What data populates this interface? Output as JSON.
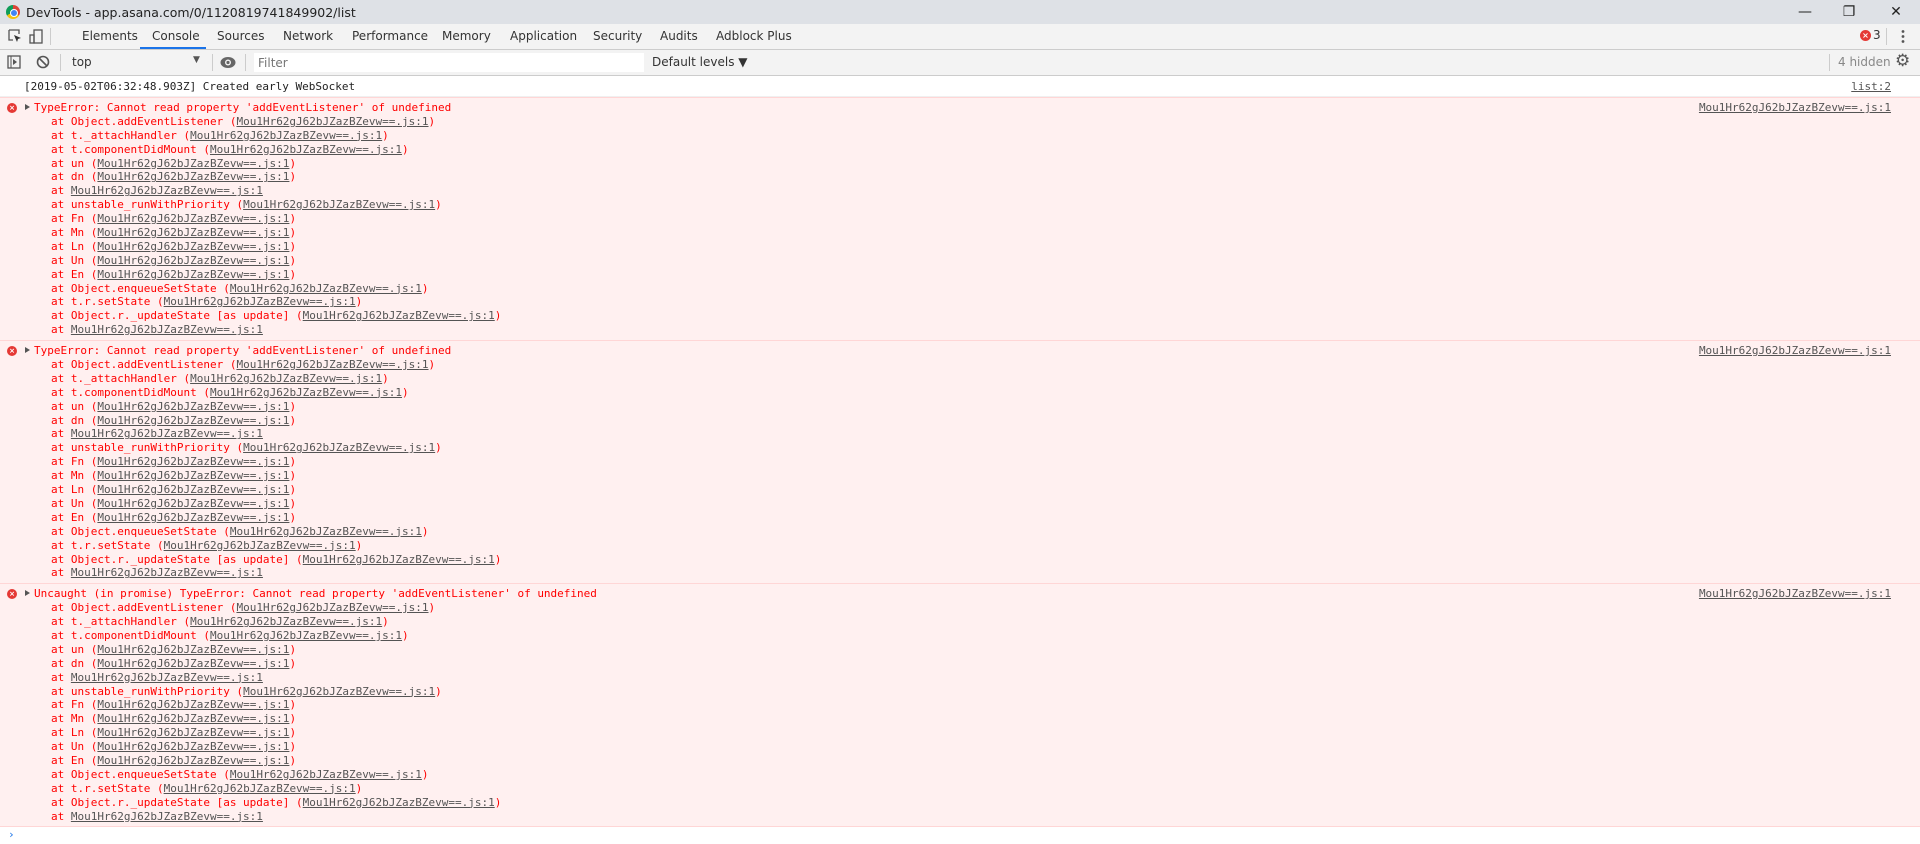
{
  "window": {
    "title": "DevTools - app.asana.com/0/1120819741849902/list",
    "minimize": "—",
    "restore": "❐",
    "close": "✕"
  },
  "tabs": [
    {
      "label": "Elements"
    },
    {
      "label": "Console",
      "active": true
    },
    {
      "label": "Sources"
    },
    {
      "label": "Network"
    },
    {
      "label": "Performance"
    },
    {
      "label": "Memory"
    },
    {
      "label": "Application"
    },
    {
      "label": "Security"
    },
    {
      "label": "Audits"
    },
    {
      "label": "Adblock Plus"
    }
  ],
  "error_count": "3",
  "toolbar": {
    "context": "top",
    "filter_placeholder": "Filter",
    "levels": "Default levels ▼",
    "hidden": "4 hidden"
  },
  "log": {
    "text": "[2019-05-02T06:32:48.903Z] Created early WebSocket",
    "source": "list:2"
  },
  "colors": {
    "error_text": "#ff0000",
    "error_bg": "#fff0f0",
    "accent": "#1a73e8"
  },
  "errors": [
    {
      "message": "TypeError: Cannot read property 'addEventListener' of undefined",
      "source": "Mou1Hr62gJ62bJZazBZevw==.js:1"
    },
    {
      "message": "TypeError: Cannot read property 'addEventListener' of undefined",
      "source": "Mou1Hr62gJ62bJZazBZevw==.js:1"
    },
    {
      "message": "Uncaught (in promise) TypeError: Cannot read property 'addEventListener' of undefined",
      "source": "Mou1Hr62gJ62bJZazBZevw==.js:1"
    }
  ],
  "stack": {
    "file": "Mou1Hr62gJ62bJZazBZevw==.js:1",
    "frames": [
      "Object.addEventListener",
      "t._attachHandler",
      "t.componentDidMount",
      "un",
      "dn",
      "",
      "unstable_runWithPriority",
      "Fn",
      "Mn",
      "Ln",
      "Un",
      "En",
      "Object.enqueueSetState",
      "t.r.setState",
      "Object.r._updateState [as update]",
      ""
    ]
  }
}
